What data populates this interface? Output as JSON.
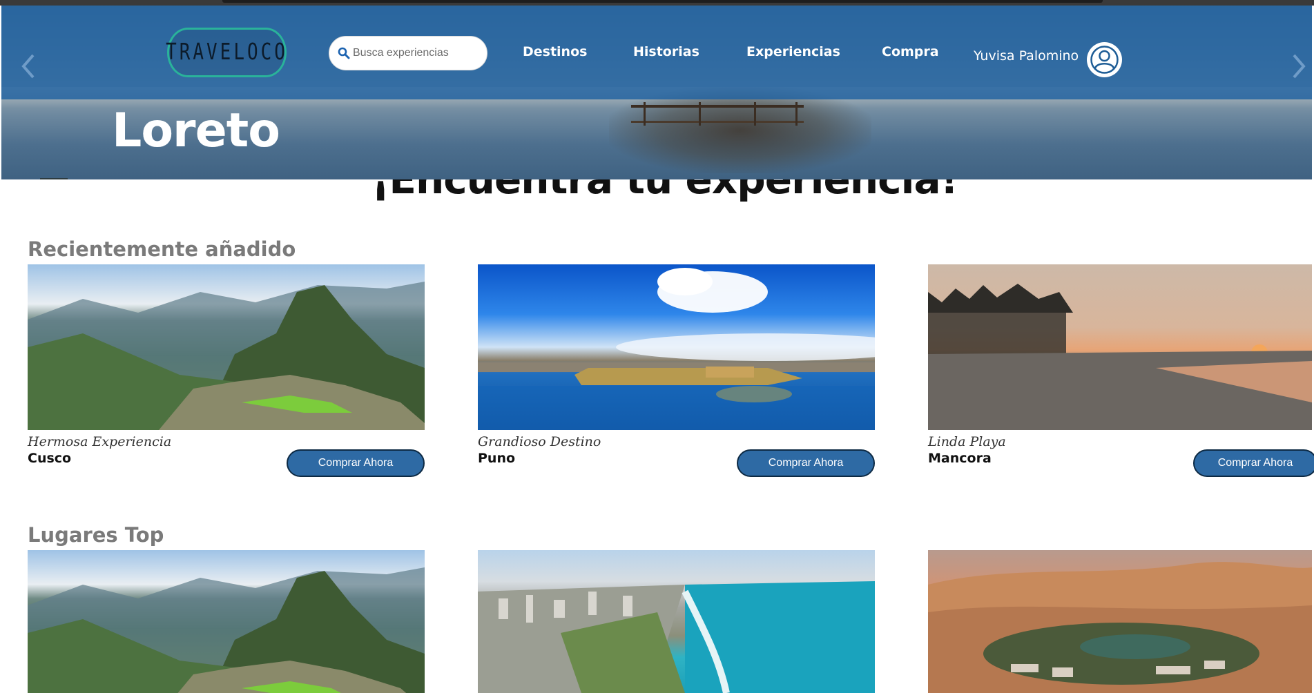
{
  "header": {
    "logo_text": "TRAVELOCO",
    "search": {
      "placeholder": "Busca experiencias"
    },
    "nav": [
      {
        "label": "Destinos"
      },
      {
        "label": "Historias"
      },
      {
        "label": "Experiencias"
      },
      {
        "label": "Compra"
      }
    ],
    "user_name": "Yuvisa Palomino"
  },
  "hero": {
    "title": "Loreto"
  },
  "main": {
    "heading": "¡Encuentra tu experiencia!",
    "sections": [
      {
        "title": "Recientemente añadido",
        "cards": [
          {
            "subtitle": "Hermosa Experiencia",
            "place": "Cusco",
            "button": "Comprar Ahora",
            "image": "machu-picchu"
          },
          {
            "subtitle": "Grandioso Destino",
            "place": "Puno",
            "button": "Comprar Ahora",
            "image": "lake-titicaca"
          },
          {
            "subtitle": "Linda Playa",
            "place": "Mancora",
            "button": "Comprar Ahora",
            "image": "mancora-beach"
          }
        ]
      },
      {
        "title": "Lugares Top",
        "cards": [
          {
            "image": "machu-picchu"
          },
          {
            "image": "lima-coast"
          },
          {
            "image": "huacachina-oasis"
          }
        ]
      }
    ]
  },
  "colors": {
    "nav_bg": "#1e60a0",
    "button_bg": "#2e6aa4",
    "logo_border": "#2ab39a",
    "section_title": "#7a7a7a"
  }
}
